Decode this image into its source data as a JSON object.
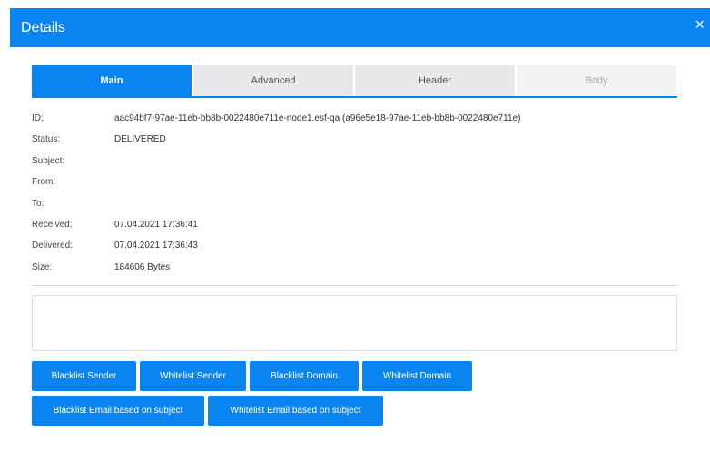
{
  "dialog": {
    "title": "Details",
    "close_icon": "×"
  },
  "tabs": [
    {
      "label": "Main",
      "state": "active"
    },
    {
      "label": "Advanced",
      "state": "normal"
    },
    {
      "label": "Header",
      "state": "normal"
    },
    {
      "label": "Body",
      "state": "disabled"
    }
  ],
  "fields": [
    {
      "label": "ID:",
      "value": "aac94bf7-97ae-11eb-bb8b-0022480e711e-node1.esf-qa (a96e5e18-97ae-11eb-bb8b-0022480e711e)"
    },
    {
      "label": "Status:",
      "value": "DELIVERED"
    },
    {
      "label": "Subject:",
      "value": ""
    },
    {
      "label": "From:",
      "value": ""
    },
    {
      "label": "To:",
      "value": ""
    },
    {
      "label": "Received:",
      "value": "07.04.2021 17:36:41"
    },
    {
      "label": "Delivered:",
      "value": "07.04.2021 17:36:43"
    },
    {
      "label": "Size:",
      "value": "184606 Bytes"
    }
  ],
  "note_text": "",
  "buttons": [
    {
      "label": "Blacklist Sender"
    },
    {
      "label": "Whitelist Sender"
    },
    {
      "label": "Blacklist Domain"
    },
    {
      "label": "Whitelist Domain"
    },
    {
      "label": "Blacklist Email based on subject"
    },
    {
      "label": "Whitelist Email based on subject"
    }
  ],
  "colors": {
    "accent": "#0a84f0",
    "tab_inactive": "#e9e9ec",
    "tab_disabled": "#f3f3f5"
  }
}
